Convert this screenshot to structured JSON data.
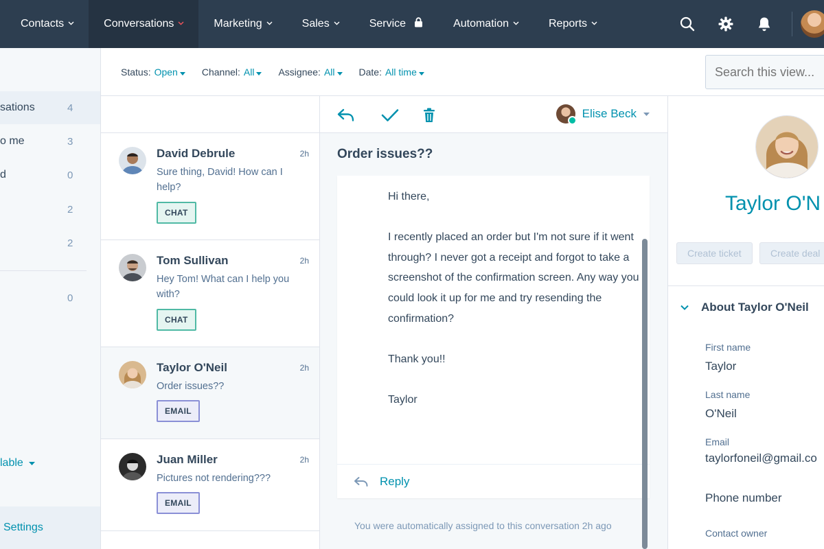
{
  "nav": {
    "items": [
      {
        "label": "Contacts",
        "chevron": true,
        "active": false
      },
      {
        "label": "Conversations",
        "chevron": true,
        "active": true
      },
      {
        "label": "Marketing",
        "chevron": true,
        "active": false
      },
      {
        "label": "Sales",
        "chevron": true,
        "active": false
      },
      {
        "label": "Service",
        "chevron": false,
        "lock": true,
        "active": false
      },
      {
        "label": "Automation",
        "chevron": true,
        "active": false
      },
      {
        "label": "Reports",
        "chevron": true,
        "active": false
      }
    ],
    "icons": [
      "search-icon",
      "gear-icon",
      "bell-icon"
    ],
    "accent_active_chevron": "#f2545b"
  },
  "sidebar": {
    "items": [
      {
        "label": "sations",
        "count": "4",
        "selected": true
      },
      {
        "label": "o me",
        "count": "3"
      },
      {
        "label": "d",
        "count": "0"
      },
      {
        "label": "",
        "count": "2"
      },
      {
        "label": "",
        "count": "2"
      },
      {
        "label": "",
        "count": "0"
      }
    ],
    "availability": "lable",
    "settings": "Settings"
  },
  "filters": [
    {
      "label": "Status:",
      "value": "Open"
    },
    {
      "label": "Channel:",
      "value": "All"
    },
    {
      "label": "Assignee:",
      "value": "All"
    },
    {
      "label": "Date:",
      "value": "All time"
    }
  ],
  "search": {
    "placeholder": "Search this view..."
  },
  "conversations": [
    {
      "name": "David Debrule",
      "time": "2h",
      "preview": "Sure thing, David! How can I help?",
      "channel": "CHAT"
    },
    {
      "name": "Tom Sullivan",
      "time": "2h",
      "preview": "Hey Tom! What can I help you with?",
      "channel": "CHAT"
    },
    {
      "name": "Taylor O'Neil",
      "time": "2h",
      "preview": "Order issues??",
      "channel": "EMAIL"
    },
    {
      "name": "Juan Miller",
      "time": "2h",
      "preview": "Pictures not rendering???",
      "channel": "EMAIL"
    }
  ],
  "thread": {
    "assignee": "Elise Beck",
    "subject": "Order issues??",
    "message": {
      "greeting": "Hi there,",
      "body": "I recently placed an order but I'm not sure if it went through? I never got a receipt and forgot to take a screenshot of the confirmation screen. Any way you could look it up for me and try resending the confirmation?",
      "thanks": "Thank you!!",
      "signature": "Taylor"
    },
    "reply_label": "Reply",
    "assigned_note": "You were automatically assigned to this conversation 2h ago"
  },
  "contact": {
    "name": "Taylor O'N",
    "buttons": [
      "Create ticket",
      "Create deal"
    ],
    "about_heading": "About Taylor O'Neil",
    "fields": [
      {
        "label": "First name",
        "value": "Taylor"
      },
      {
        "label": "Last name",
        "value": "O'Neil"
      },
      {
        "label": "Email",
        "value": "taylorfoneil@gmail.co"
      },
      {
        "label": "Phone number",
        "value": ""
      },
      {
        "label": "Contact owner",
        "value": ""
      }
    ]
  }
}
